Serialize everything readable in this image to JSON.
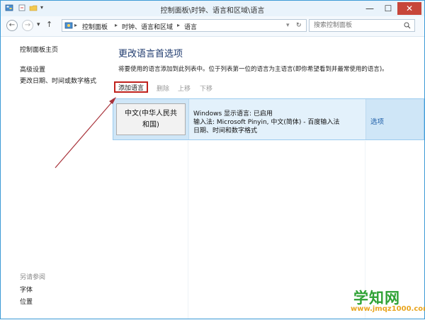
{
  "window": {
    "title": "控制面板\\时钟、语言和区域\\语言",
    "minimize_glyph": "—",
    "maximize_glyph": "☐",
    "close_glyph": "✕"
  },
  "nav": {
    "back_glyph": "←",
    "forward_glyph": "→",
    "dropdown_glyph": "▾",
    "up_glyph": "↑"
  },
  "address": {
    "crumbs": [
      "控制面板",
      "时钟、语言和区域",
      "语言"
    ],
    "separator": "▸",
    "refresh_glyph": "↻"
  },
  "search": {
    "placeholder": "搜索控制面板"
  },
  "sidebar": {
    "items": [
      {
        "label": "控制面板主页"
      },
      {
        "label": "高级设置"
      },
      {
        "label": "更改日期、时间或数字格式"
      }
    ],
    "see_also_label": "另请参阅",
    "see_also": [
      {
        "label": "字体"
      },
      {
        "label": "位置"
      }
    ]
  },
  "main": {
    "heading": "更改语言首选项",
    "description": "将要使用的语言添加到此列表中。位于列表第一位的语言为主语言(即你希望看到并最常使用的语言)。",
    "toolbar": {
      "add_label": "添加语言",
      "remove_label": "删除",
      "up_label": "上移",
      "down_label": "下移"
    },
    "languages": [
      {
        "name_line1": "中文(中华人民共",
        "name_line2": "和国)",
        "display_status": "Windows 显示语言: 已启用",
        "input_method": "输入法: Microsoft Pinyin, 中文(简体) - 百度输入法",
        "format": "日期、时间和数字格式",
        "options_label": "选项"
      }
    ]
  },
  "watermark": {
    "main": "学知网",
    "url": "www.jmqz1000.com"
  },
  "colors": {
    "selected_row": "#cfe6f7",
    "annotation_red": "#c0221d",
    "link_blue": "#1f5fa8",
    "watermark_green": "#2fa235",
    "watermark_orange": "#e9a51e"
  }
}
